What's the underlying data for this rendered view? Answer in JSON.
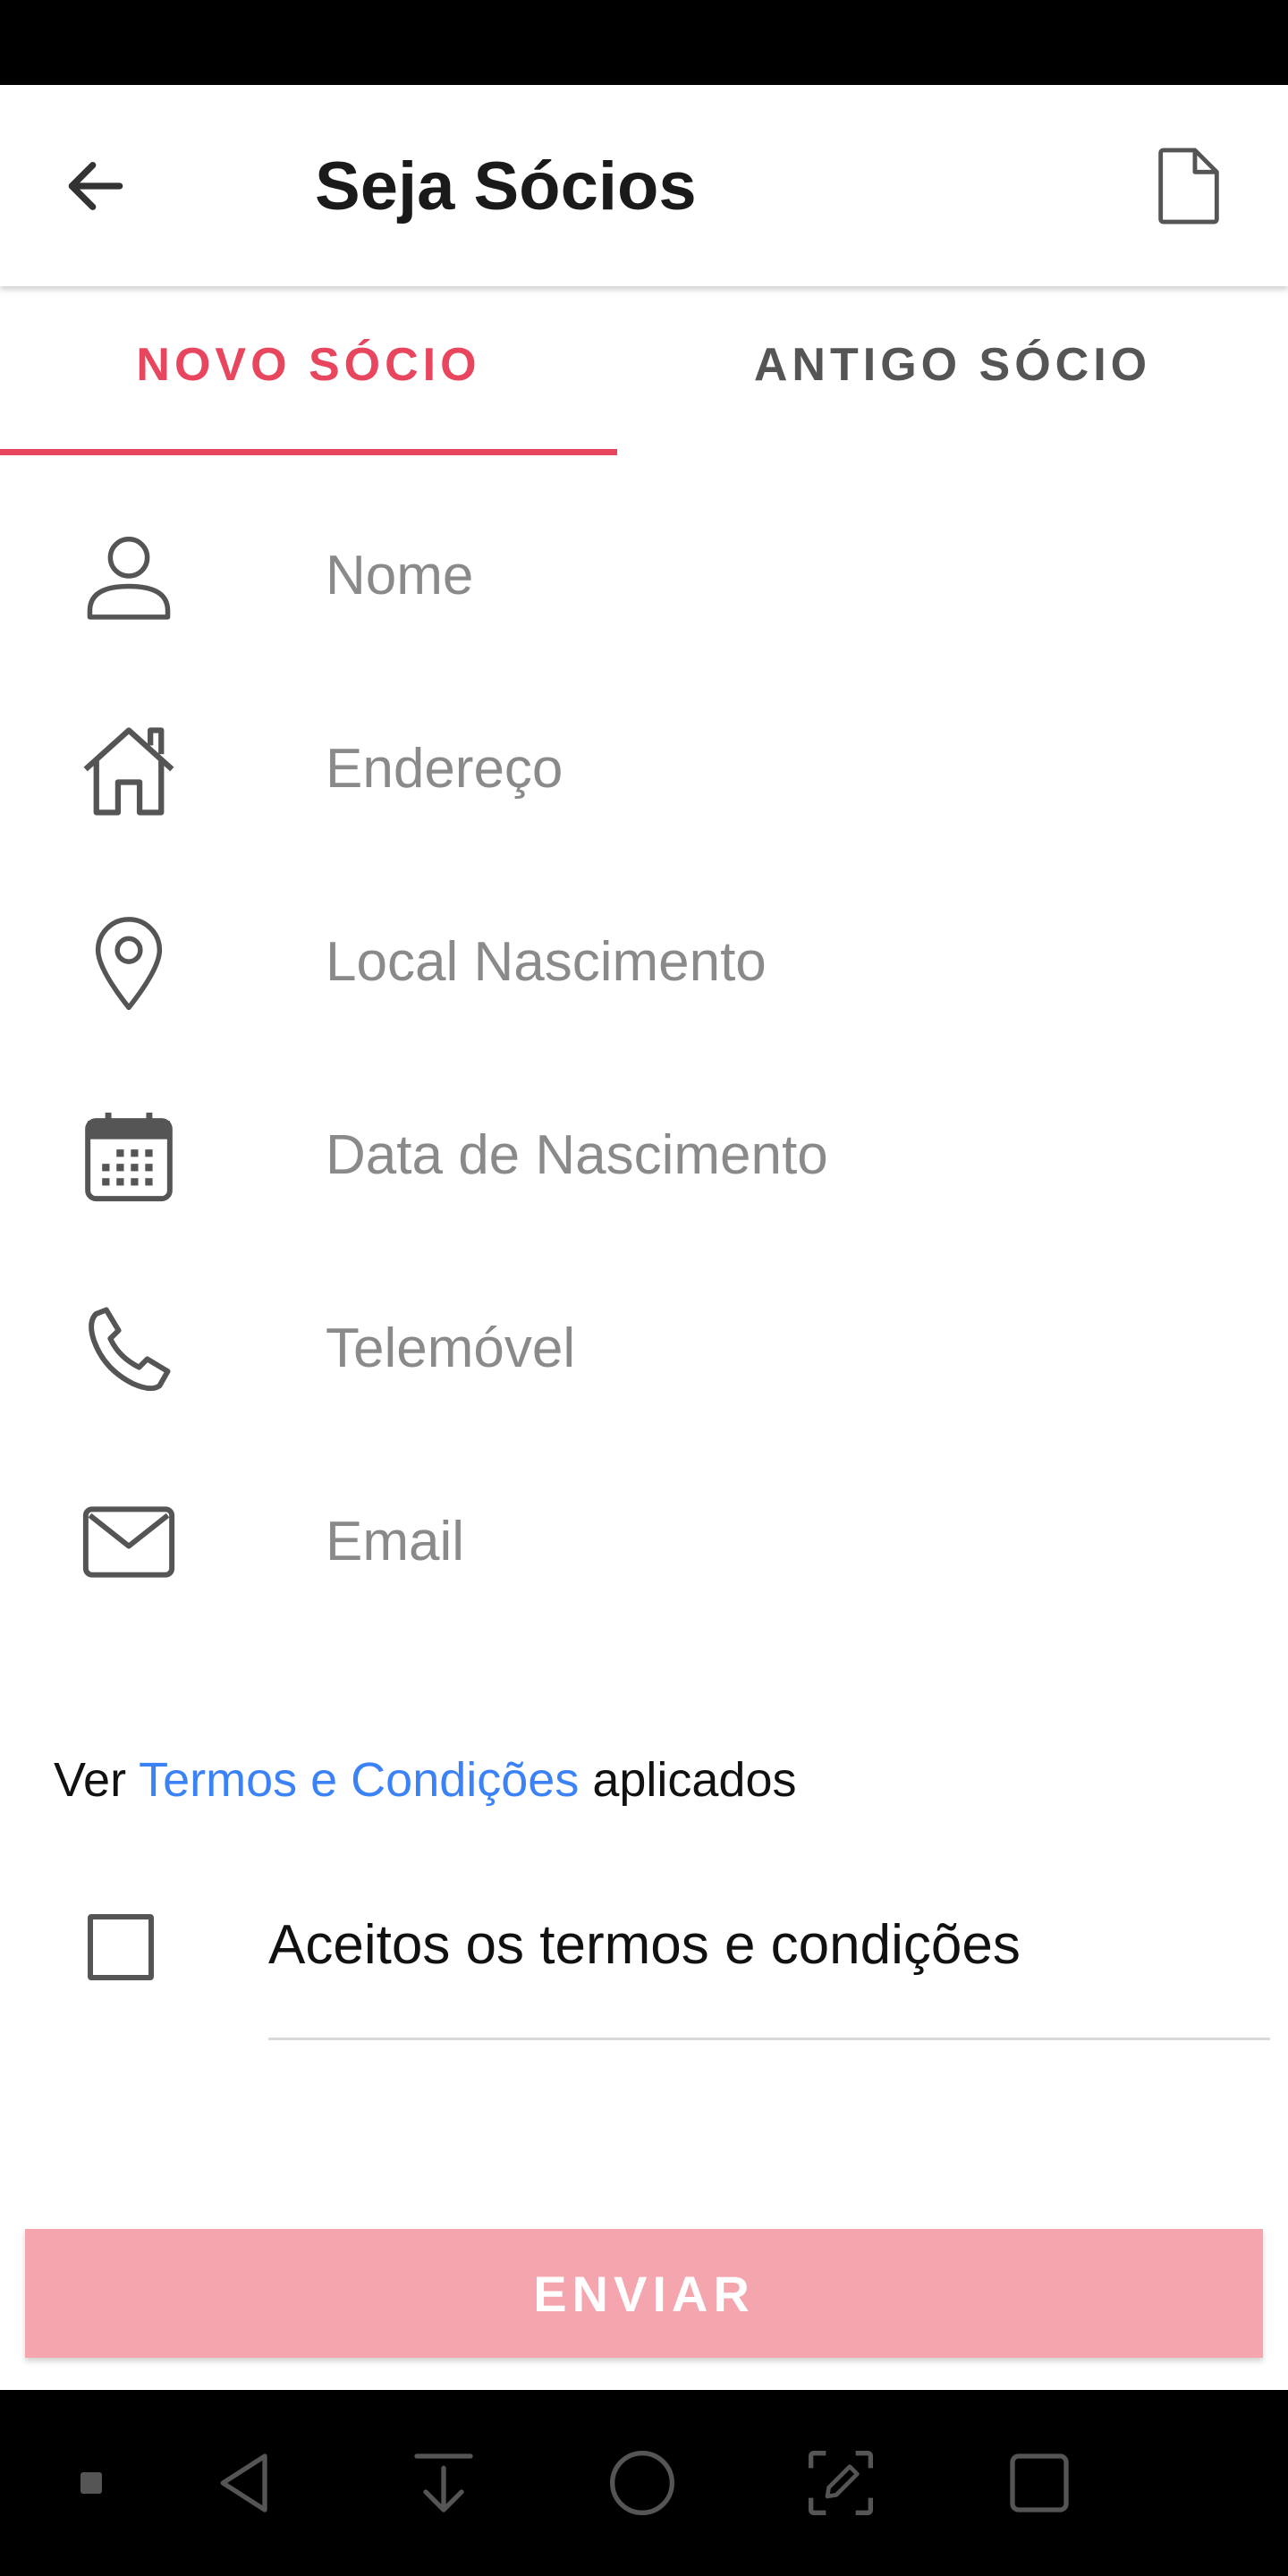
{
  "header": {
    "title": "Seja Sócios",
    "back_icon": "arrow-left-icon",
    "action_icon": "document-icon"
  },
  "tabs": [
    {
      "label": "NOVO SÓCIO",
      "active": true
    },
    {
      "label": "ANTIGO SÓCIO",
      "active": false
    }
  ],
  "form": {
    "fields": [
      {
        "placeholder": "Nome",
        "value": "",
        "icon": "person-icon"
      },
      {
        "placeholder": "Endereço",
        "value": "",
        "icon": "house-icon"
      },
      {
        "placeholder": "Local Nascimento",
        "value": "",
        "icon": "location-pin-icon"
      },
      {
        "placeholder": "Data de Nascimento",
        "value": "",
        "icon": "calendar-icon"
      },
      {
        "placeholder": "Telemóvel",
        "value": "",
        "icon": "phone-icon"
      },
      {
        "placeholder": "Email",
        "value": "",
        "icon": "envelope-icon"
      }
    ],
    "terms_prefix": "Ver",
    "terms_link": "Termos e Condições",
    "terms_suffix": "aplicados",
    "accept_label": "Aceitos os termos e condições",
    "accept_checked": false,
    "submit_label": "ENVIAR"
  },
  "colors": {
    "accent": "#e8455e",
    "link": "#3b82f6",
    "submit_background": "#f4a5ae"
  },
  "system_nav": {
    "icons": [
      "dot-icon",
      "nav-back-icon",
      "download-icon",
      "home-icon",
      "screenshot-edit-icon",
      "recents-icon"
    ]
  }
}
